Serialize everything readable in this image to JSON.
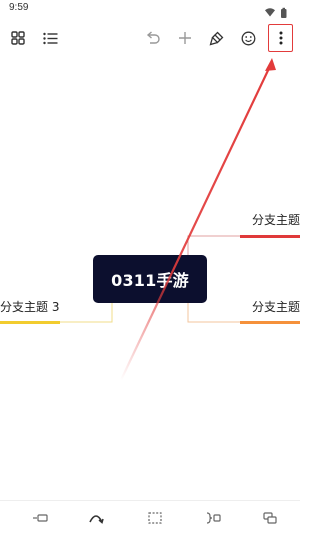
{
  "status_bar": {
    "time": "9:59",
    "icons": [
      "wifi-icon",
      "battery-icon"
    ]
  },
  "toolbar": {
    "left_icons": [
      "grid-view-icon",
      "outline-list-icon"
    ],
    "right_icons": [
      "undo-icon",
      "add-icon",
      "format-brush-icon",
      "emoji-icon",
      "more-options-icon"
    ]
  },
  "mindmap": {
    "central_topic": "0311手游",
    "branches": [
      {
        "label": "分支主题",
        "color": "#e0393a"
      },
      {
        "label": "分支主题",
        "color": "#f5913b"
      },
      {
        "label": "分支主题 3",
        "color": "#f2cc2e"
      }
    ]
  },
  "bottom_bar": {
    "icons": [
      "insert-sibling-icon",
      "connect-relation-icon",
      "boundary-icon",
      "summary-icon",
      "floating-topic-icon"
    ]
  },
  "colors": {
    "central_bg": "#0c0f2e",
    "annotation_red": "#e23b3b",
    "connector_gray": "#c9c9c9"
  }
}
